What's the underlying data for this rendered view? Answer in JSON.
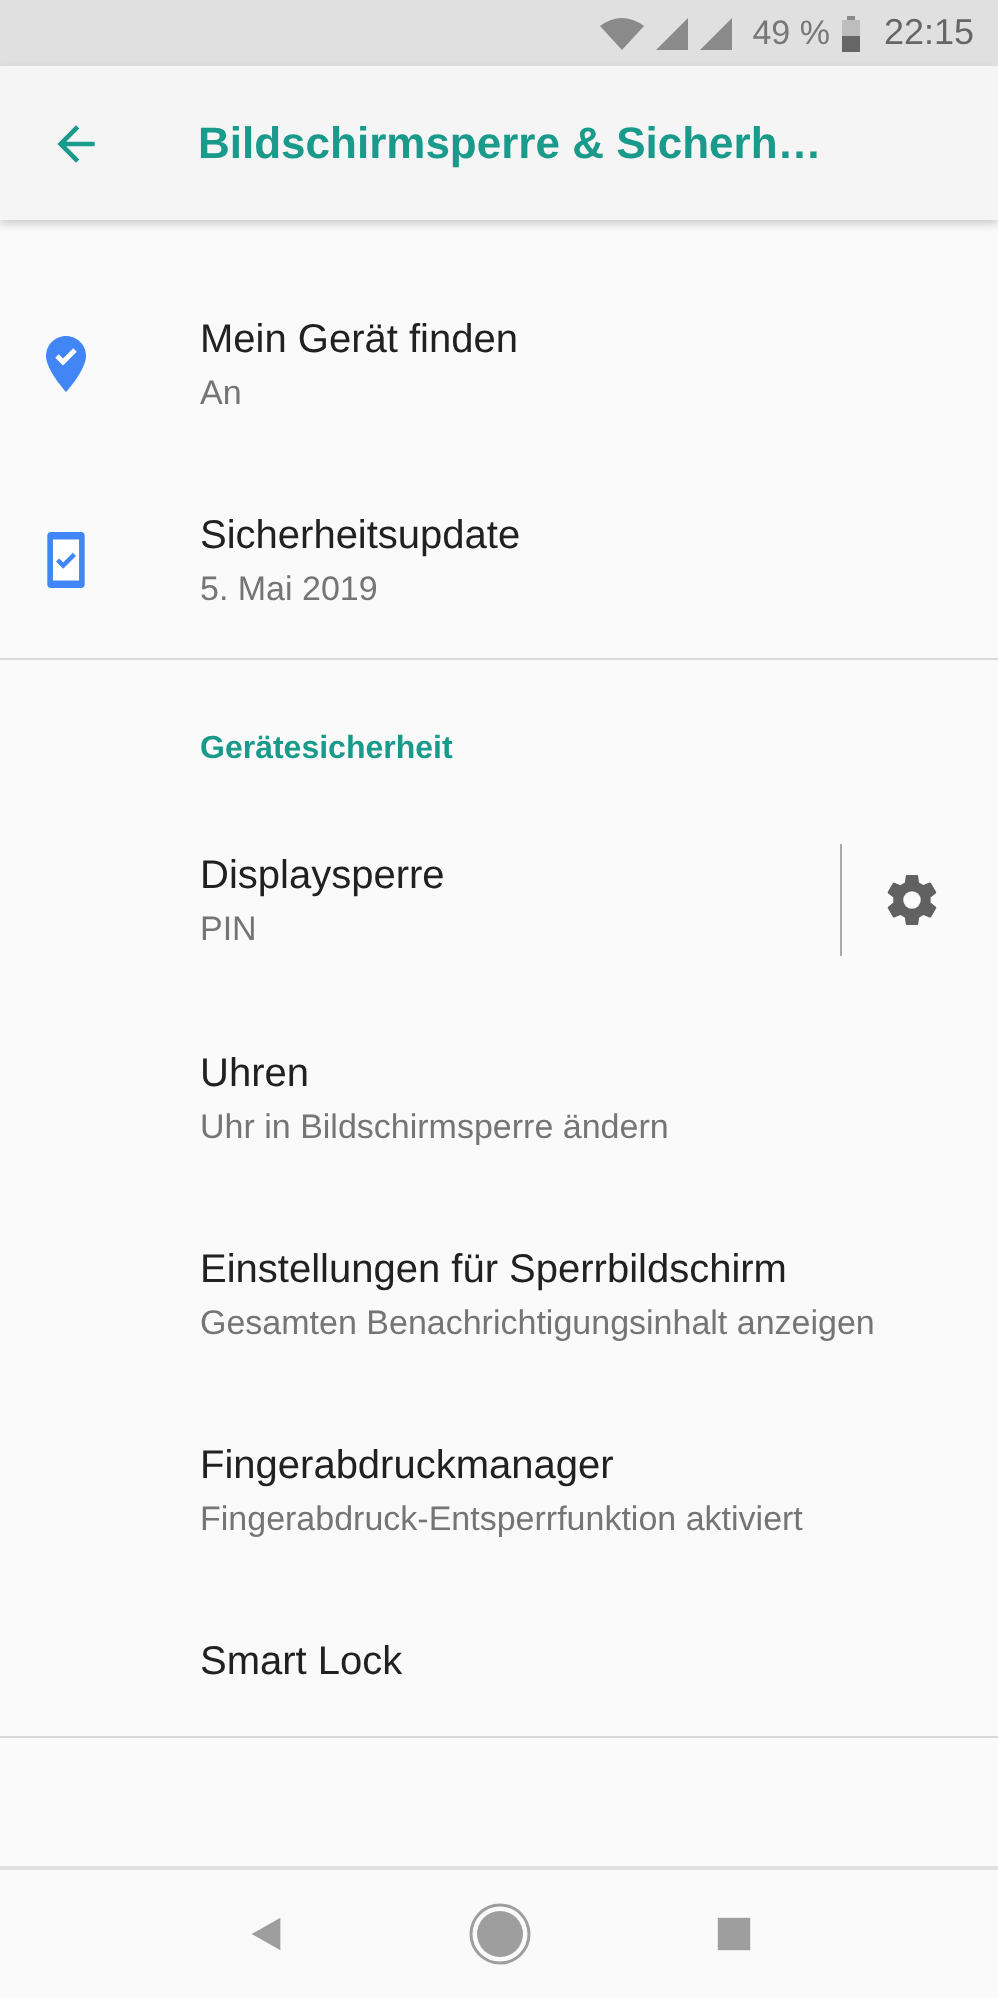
{
  "status_bar": {
    "battery": "49 %",
    "time": "22:15"
  },
  "app_bar": {
    "title": "Bildschirmsperre & Sicherh…"
  },
  "top_items": [
    {
      "kind": "pin",
      "title": "Mein Gerät finden",
      "subtitle": "An"
    },
    {
      "kind": "phone",
      "title": "Sicherheitsupdate",
      "subtitle": "5. Mai 2019"
    }
  ],
  "section": {
    "header": "Gerätesicherheit",
    "items": [
      {
        "kind": "settings",
        "title": "Displaysperre",
        "subtitle": "PIN"
      },
      {
        "kind": "plain",
        "title": "Uhren",
        "subtitle": "Uhr in Bildschirmsperre ändern"
      },
      {
        "kind": "plain",
        "title": "Einstellungen für Sperrbildschirm",
        "subtitle": "Gesamten Benachrichtigungsinhalt anzeigen"
      },
      {
        "kind": "plain",
        "title": "Fingerabdruckmanager",
        "subtitle": "Fingerabdruck-Entsperrfunktion aktiviert"
      },
      {
        "kind": "plain",
        "title": "Smart Lock"
      }
    ]
  }
}
